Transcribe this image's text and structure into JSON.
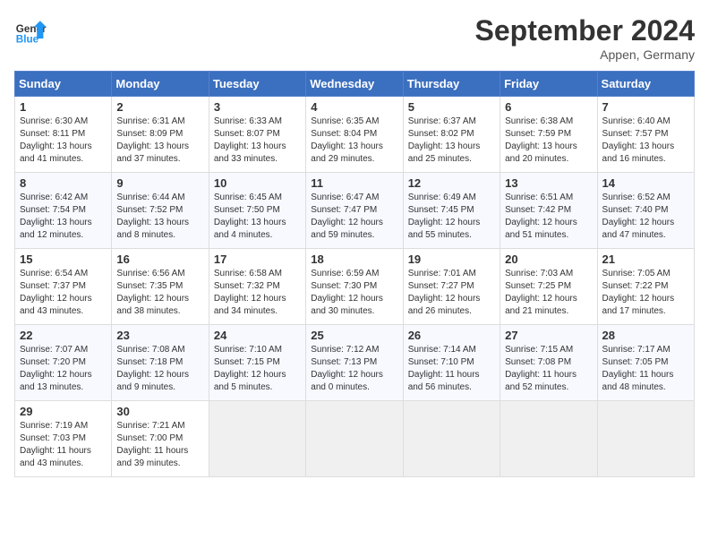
{
  "header": {
    "logo_text_general": "General",
    "logo_text_blue": "Blue",
    "month_title": "September 2024",
    "location": "Appen, Germany"
  },
  "weekdays": [
    "Sunday",
    "Monday",
    "Tuesday",
    "Wednesday",
    "Thursday",
    "Friday",
    "Saturday"
  ],
  "weeks": [
    [
      {
        "day": "1",
        "sunrise": "6:30 AM",
        "sunset": "8:11 PM",
        "daylight": "13 hours and 41 minutes."
      },
      {
        "day": "2",
        "sunrise": "6:31 AM",
        "sunset": "8:09 PM",
        "daylight": "13 hours and 37 minutes."
      },
      {
        "day": "3",
        "sunrise": "6:33 AM",
        "sunset": "8:07 PM",
        "daylight": "13 hours and 33 minutes."
      },
      {
        "day": "4",
        "sunrise": "6:35 AM",
        "sunset": "8:04 PM",
        "daylight": "13 hours and 29 minutes."
      },
      {
        "day": "5",
        "sunrise": "6:37 AM",
        "sunset": "8:02 PM",
        "daylight": "13 hours and 25 minutes."
      },
      {
        "day": "6",
        "sunrise": "6:38 AM",
        "sunset": "7:59 PM",
        "daylight": "13 hours and 20 minutes."
      },
      {
        "day": "7",
        "sunrise": "6:40 AM",
        "sunset": "7:57 PM",
        "daylight": "13 hours and 16 minutes."
      }
    ],
    [
      {
        "day": "8",
        "sunrise": "6:42 AM",
        "sunset": "7:54 PM",
        "daylight": "13 hours and 12 minutes."
      },
      {
        "day": "9",
        "sunrise": "6:44 AM",
        "sunset": "7:52 PM",
        "daylight": "13 hours and 8 minutes."
      },
      {
        "day": "10",
        "sunrise": "6:45 AM",
        "sunset": "7:50 PM",
        "daylight": "13 hours and 4 minutes."
      },
      {
        "day": "11",
        "sunrise": "6:47 AM",
        "sunset": "7:47 PM",
        "daylight": "12 hours and 59 minutes."
      },
      {
        "day": "12",
        "sunrise": "6:49 AM",
        "sunset": "7:45 PM",
        "daylight": "12 hours and 55 minutes."
      },
      {
        "day": "13",
        "sunrise": "6:51 AM",
        "sunset": "7:42 PM",
        "daylight": "12 hours and 51 minutes."
      },
      {
        "day": "14",
        "sunrise": "6:52 AM",
        "sunset": "7:40 PM",
        "daylight": "12 hours and 47 minutes."
      }
    ],
    [
      {
        "day": "15",
        "sunrise": "6:54 AM",
        "sunset": "7:37 PM",
        "daylight": "12 hours and 43 minutes."
      },
      {
        "day": "16",
        "sunrise": "6:56 AM",
        "sunset": "7:35 PM",
        "daylight": "12 hours and 38 minutes."
      },
      {
        "day": "17",
        "sunrise": "6:58 AM",
        "sunset": "7:32 PM",
        "daylight": "12 hours and 34 minutes."
      },
      {
        "day": "18",
        "sunrise": "6:59 AM",
        "sunset": "7:30 PM",
        "daylight": "12 hours and 30 minutes."
      },
      {
        "day": "19",
        "sunrise": "7:01 AM",
        "sunset": "7:27 PM",
        "daylight": "12 hours and 26 minutes."
      },
      {
        "day": "20",
        "sunrise": "7:03 AM",
        "sunset": "7:25 PM",
        "daylight": "12 hours and 21 minutes."
      },
      {
        "day": "21",
        "sunrise": "7:05 AM",
        "sunset": "7:22 PM",
        "daylight": "12 hours and 17 minutes."
      }
    ],
    [
      {
        "day": "22",
        "sunrise": "7:07 AM",
        "sunset": "7:20 PM",
        "daylight": "12 hours and 13 minutes."
      },
      {
        "day": "23",
        "sunrise": "7:08 AM",
        "sunset": "7:18 PM",
        "daylight": "12 hours and 9 minutes."
      },
      {
        "day": "24",
        "sunrise": "7:10 AM",
        "sunset": "7:15 PM",
        "daylight": "12 hours and 5 minutes."
      },
      {
        "day": "25",
        "sunrise": "7:12 AM",
        "sunset": "7:13 PM",
        "daylight": "12 hours and 0 minutes."
      },
      {
        "day": "26",
        "sunrise": "7:14 AM",
        "sunset": "7:10 PM",
        "daylight": "11 hours and 56 minutes."
      },
      {
        "day": "27",
        "sunrise": "7:15 AM",
        "sunset": "7:08 PM",
        "daylight": "11 hours and 52 minutes."
      },
      {
        "day": "28",
        "sunrise": "7:17 AM",
        "sunset": "7:05 PM",
        "daylight": "11 hours and 48 minutes."
      }
    ],
    [
      {
        "day": "29",
        "sunrise": "7:19 AM",
        "sunset": "7:03 PM",
        "daylight": "11 hours and 43 minutes."
      },
      {
        "day": "30",
        "sunrise": "7:21 AM",
        "sunset": "7:00 PM",
        "daylight": "11 hours and 39 minutes."
      },
      null,
      null,
      null,
      null,
      null
    ]
  ],
  "labels": {
    "sunrise": "Sunrise:",
    "sunset": "Sunset:",
    "daylight": "Daylight:"
  }
}
